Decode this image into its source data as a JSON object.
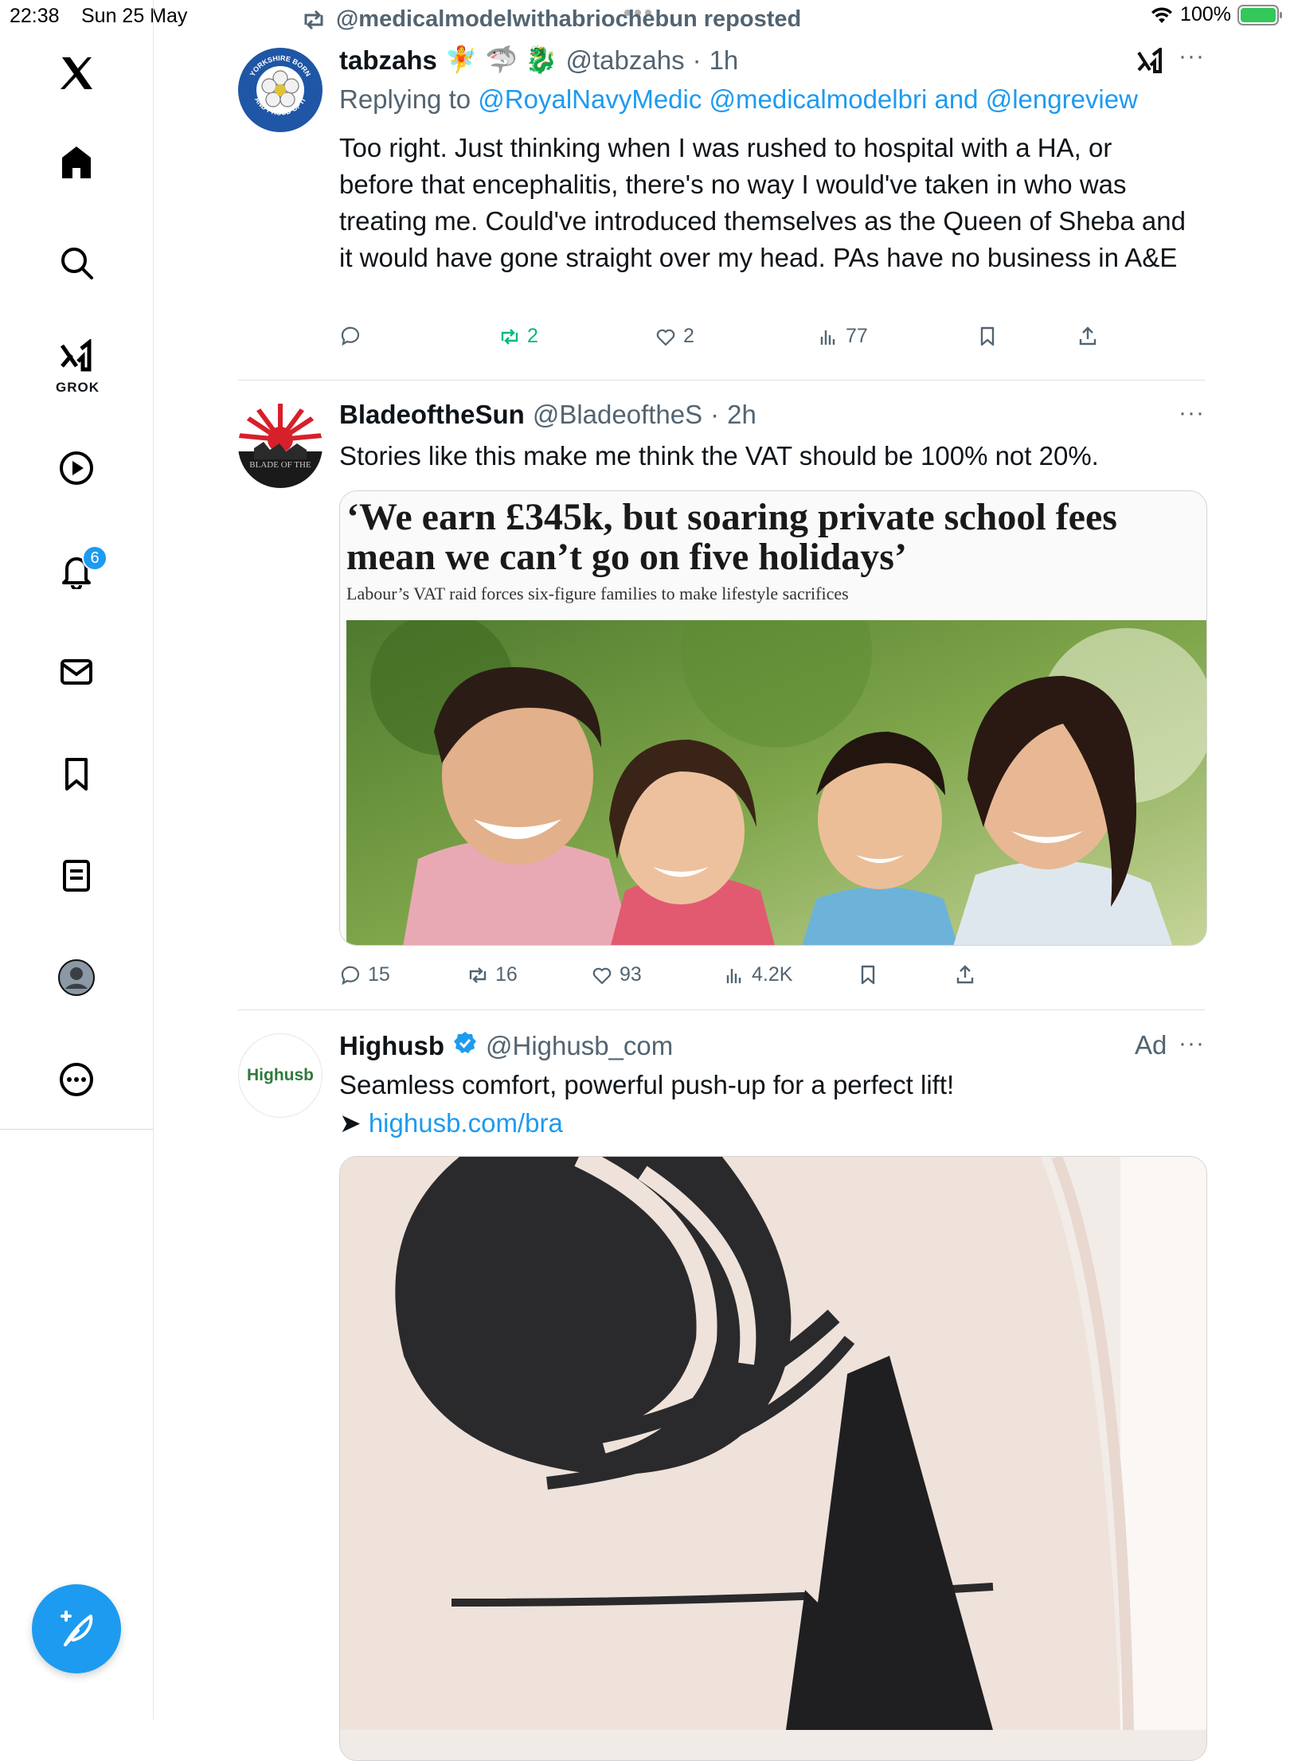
{
  "status_bar": {
    "time": "22:38",
    "date": "Sun 25 May",
    "battery": "100%",
    "battery_level": 1.0
  },
  "sidebar": {
    "items": [
      {
        "name": "x-logo",
        "label": "X"
      },
      {
        "name": "home",
        "label": "Home"
      },
      {
        "name": "explore",
        "label": "Search"
      },
      {
        "name": "grok",
        "label": "GROK"
      },
      {
        "name": "video",
        "label": "Video"
      },
      {
        "name": "notifications",
        "label": "Notifications",
        "badge": "6"
      },
      {
        "name": "messages",
        "label": "Messages"
      },
      {
        "name": "bookmarks",
        "label": "Bookmarks"
      },
      {
        "name": "lists",
        "label": "Lists"
      },
      {
        "name": "profile",
        "label": "Profile"
      },
      {
        "name": "more",
        "label": "More"
      }
    ],
    "grok_label": "GROK",
    "notification_badge": "6"
  },
  "accent_color": "#1d9bf0",
  "repost_banner": "@medicalmodelwithabriochebun reposted",
  "tweets": [
    {
      "display_name": "tabzahs",
      "emojis": "🧚 🦈 🐉",
      "handle": "@tabzahs",
      "time": "1h",
      "avatar_text_top": "YORKSHIRE BORN",
      "avatar_text_bottom": "AND PROUD OF IT",
      "replying_prefix": "Replying to",
      "replying_to": "@RoyalNavyMedic @medicalmodelbri and @lengreview",
      "text": "Too right. Just thinking when I was rushed to hospital with a HA, or before that encephalitis, there's no way I would've taken in who was treating me. Could've introduced themselves as the Queen of Sheba and it would have gone straight over my head. PAs have no business in A&E",
      "replies": "",
      "reposts": "2",
      "likes": "2",
      "views": "77"
    },
    {
      "display_name": "BladeoftheSun",
      "handle": "@BladeoftheS",
      "time": "2h",
      "avatar_text": "BLADE OF THE",
      "text": "Stories like this make me think the VAT should be 100% not 20%.",
      "headline": "‘We earn £345k, but soaring private school fees mean we can’t go on five holidays’",
      "subhead": "Labour’s VAT raid forces six-figure families to make lifestyle sacrifices",
      "replies": "15",
      "reposts": "16",
      "likes": "93",
      "views": "4.2K"
    },
    {
      "display_name": "Highusb",
      "handle": "@Highusb_com",
      "ad_label": "Ad",
      "avatar_text": "Highusb",
      "text": "Seamless comfort, powerful push-up for a perfect lift!",
      "link_arrow": "➤",
      "link": "highusb.com/bra"
    }
  ]
}
